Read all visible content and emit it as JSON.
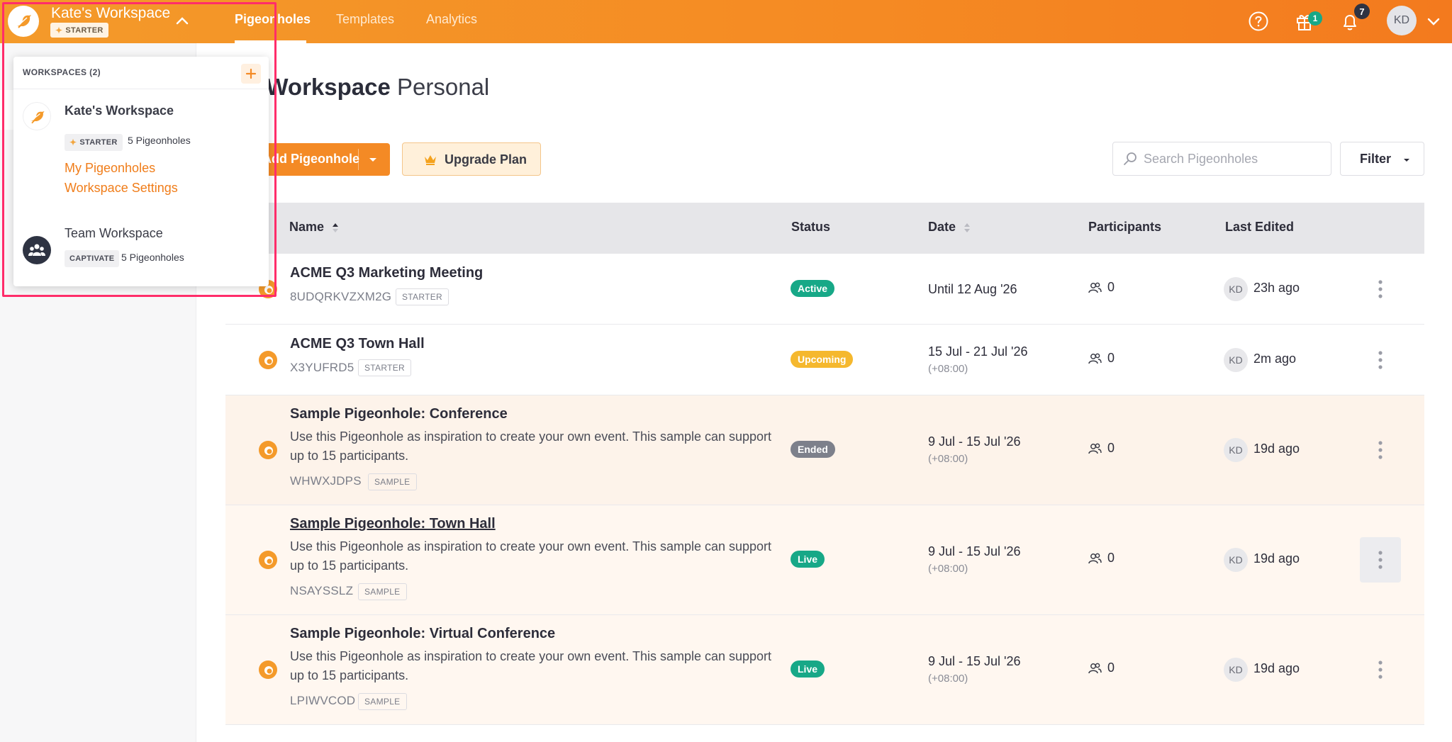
{
  "header": {
    "workspace_name": "Kate's Workspace",
    "workspace_plan": "STARTER",
    "tabs": [
      {
        "label": "Pigeonholes",
        "active": true
      },
      {
        "label": "Templates",
        "active": false
      },
      {
        "label": "Analytics",
        "active": false
      }
    ],
    "gift_badge": "1",
    "notification_badge": "7",
    "user_initials": "KD",
    "brand_color": "#f58a23"
  },
  "page": {
    "title_bold": "'s Workspace",
    "title_light": "Personal"
  },
  "toolbar": {
    "add_label": "Add Pigeonhole",
    "upgrade_label": "Upgrade Plan",
    "search_placeholder": "Search Pigeonholes",
    "filter_label": "Filter"
  },
  "table": {
    "columns": {
      "name": "Name",
      "status": "Status",
      "date": "Date",
      "participants": "Participants",
      "last_edited": "Last Edited"
    },
    "rows": [
      {
        "title": "ACME Q3 Marketing Meeting",
        "description": "",
        "code": "8UDQRKVZXM2G",
        "tag": "STARTER",
        "status": "Active",
        "status_color": "#17a887",
        "date": "Until 12 Aug '26",
        "date_sub": "",
        "participants": "0",
        "editor": "KD",
        "last_edited": "23h ago"
      },
      {
        "title": "ACME Q3 Town Hall",
        "description": "",
        "code": "X3YUFRD5",
        "tag": "STARTER",
        "status": "Upcoming",
        "status_color": "#f5b82e",
        "date": "15 Jul - 21 Jul '26",
        "date_sub": "(+08:00)",
        "participants": "0",
        "editor": "KD",
        "last_edited": "2m ago"
      },
      {
        "title": "Sample Pigeonhole: Conference",
        "description": "Use this Pigeonhole as inspiration to create your own event. This sample can support up to 15 participants.",
        "code": "WHWXJDPS",
        "tag": "SAMPLE",
        "status": "Ended",
        "status_color": "#7d808b",
        "date": "9 Jul - 15 Jul '26",
        "date_sub": "(+08:00)",
        "participants": "0",
        "editor": "KD",
        "last_edited": "19d ago"
      },
      {
        "title": "Sample Pigeonhole: Town Hall",
        "description": "Use this Pigeonhole as inspiration to create your own event. This sample can support up to 15 participants.",
        "code": "NSAYSSLZ",
        "tag": "SAMPLE",
        "status": "Live",
        "status_color": "#17a887",
        "date": "9 Jul - 15 Jul '26",
        "date_sub": "(+08:00)",
        "participants": "0",
        "editor": "KD",
        "last_edited": "19d ago"
      },
      {
        "title": "Sample Pigeonhole: Virtual Conference",
        "description": "Use this Pigeonhole as inspiration to create your own event. This sample can support up to 15 participants.",
        "code": "LPIWVCOD",
        "tag": "SAMPLE",
        "status": "Live",
        "status_color": "#17a887",
        "date": "9 Jul - 15 Jul '26",
        "date_sub": "(+08:00)",
        "participants": "0",
        "editor": "KD",
        "last_edited": "19d ago"
      }
    ]
  },
  "workspace_menu": {
    "header": "WORKSPACES (2)",
    "workspaces": [
      {
        "name": "Kate's Workspace",
        "plan": "STARTER",
        "count": "5 Pigeonholes",
        "links": [
          "My Pigeonholes",
          "Workspace Settings"
        ]
      },
      {
        "name": "Team Workspace",
        "plan": "CAPTIVATE",
        "count": "5 Pigeonholes"
      }
    ]
  }
}
